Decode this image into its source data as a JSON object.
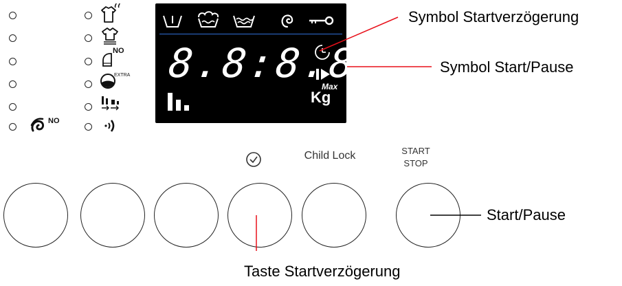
{
  "display": {
    "digits": "8.8:8.8.",
    "kg_label": "Kg",
    "max_label": "Max"
  },
  "symbols": {
    "no_label_left": "NO",
    "no_label_right": "NO",
    "extra_label": "EXTRA"
  },
  "panel_labels": {
    "child_lock": "Child Lock",
    "start_stop_line1": "START",
    "start_stop_line2": "STOP"
  },
  "callouts": {
    "delay_symbol": "Symbol Startverzögerung",
    "start_pause_symbol": "Symbol Start/Pause",
    "start_pause_button": "Start/Pause",
    "delay_button": "Taste Startverzögerung"
  },
  "icons": [
    "prewash-icon",
    "wash-icon",
    "rinse-icon",
    "spin-icon",
    "key-icon",
    "delay-timer-icon",
    "play-pause-icon",
    "load-bars-icon",
    "clock-icon",
    "shirt-steam-icon",
    "shirt-icon",
    "iron-no-icon",
    "drum-extra-icon",
    "rinse-bars-icon",
    "sound-icon",
    "no-spin-icon"
  ],
  "colors": {
    "display_bg": "#000000",
    "callout_line": "#e8101a",
    "separator_line": "#2f6fd8"
  }
}
